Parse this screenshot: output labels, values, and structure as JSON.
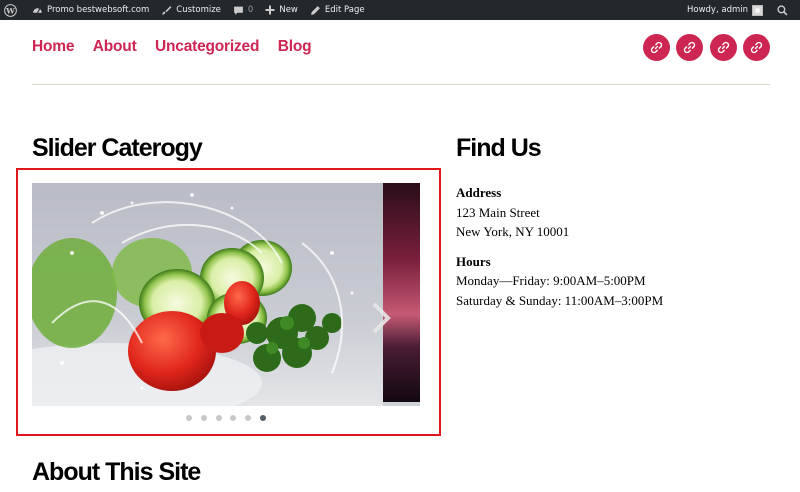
{
  "adminbar": {
    "site_name": "Promo bestwebsoft.com",
    "customize": "Customize",
    "comments_count": "0",
    "new": "New",
    "edit_page": "Edit Page",
    "howdy": "Howdy, admin"
  },
  "nav": {
    "items": [
      {
        "label": "Home"
      },
      {
        "label": "About"
      },
      {
        "label": "Uncategorized"
      },
      {
        "label": "Blog"
      }
    ]
  },
  "social": {
    "count": 4,
    "icon": "link-icon",
    "color": "#cd2653"
  },
  "slider_widget": {
    "title": "Slider Caterogy",
    "slide_count": 6,
    "active_slide": 6,
    "highlight_color": "#e0161a"
  },
  "find_us": {
    "title": "Find Us",
    "address_label": "Address",
    "address_line1": "123 Main Street",
    "address_line2": "New York, NY 10001",
    "hours_label": "Hours",
    "hours_line1": "Monday—Friday: 9:00AM–5:00PM",
    "hours_line2": "Saturday & Sunday: 11:00AM–3:00PM"
  },
  "about": {
    "title": "About This Site"
  },
  "colors": {
    "accent": "#cd2653",
    "adminbar_bg": "#23282d"
  }
}
